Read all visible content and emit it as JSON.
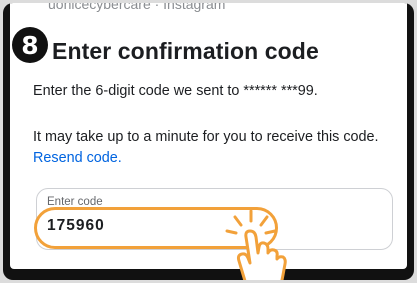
{
  "header": {
    "account_line": "uonicecybercare · Instagram",
    "step_number": "8",
    "title": "Enter confirmation code"
  },
  "instructions": {
    "sent_to": "Enter the 6-digit code we sent to ****** ***99.",
    "wait_text": "It may take up to a minute for you to receive this code.",
    "resend_link": "Resend code."
  },
  "code_field": {
    "label": "Enter code",
    "value": "175960"
  },
  "icons": {
    "tap_hand": "tap-hand-icon"
  },
  "colors": {
    "link": "#0064e0",
    "highlight": "#f2a13a",
    "frame": "#111111"
  }
}
